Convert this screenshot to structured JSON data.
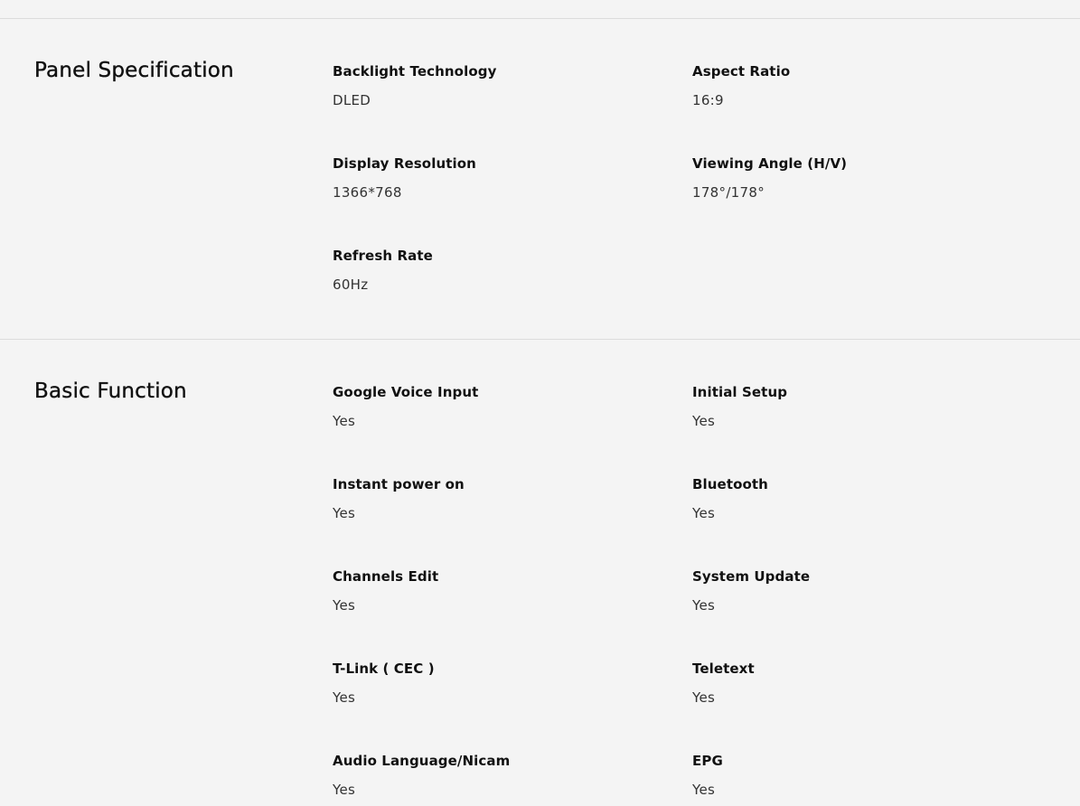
{
  "sections": [
    {
      "title": "Panel Specification",
      "specs": [
        {
          "label": "Backlight Technology",
          "value": "DLED"
        },
        {
          "label": "Aspect Ratio",
          "value": "16:9"
        },
        {
          "label": "Display Resolution",
          "value": "1366*768"
        },
        {
          "label": "Viewing Angle (H/V)",
          "value": "178°/178°"
        },
        {
          "label": "Refresh Rate",
          "value": "60Hz"
        }
      ]
    },
    {
      "title": "Basic Function",
      "specs": [
        {
          "label": "Google Voice Input",
          "value": "Yes"
        },
        {
          "label": "Initial Setup",
          "value": "Yes"
        },
        {
          "label": "Instant power on",
          "value": "Yes"
        },
        {
          "label": "Bluetooth",
          "value": "Yes"
        },
        {
          "label": "Channels Edit",
          "value": "Yes"
        },
        {
          "label": "System Update",
          "value": "Yes"
        },
        {
          "label": "T-Link ( CEC )",
          "value": "Yes"
        },
        {
          "label": "Teletext",
          "value": "Yes"
        },
        {
          "label": "Audio Language/Nicam",
          "value": "Yes"
        },
        {
          "label": "EPG",
          "value": "Yes"
        }
      ]
    }
  ]
}
